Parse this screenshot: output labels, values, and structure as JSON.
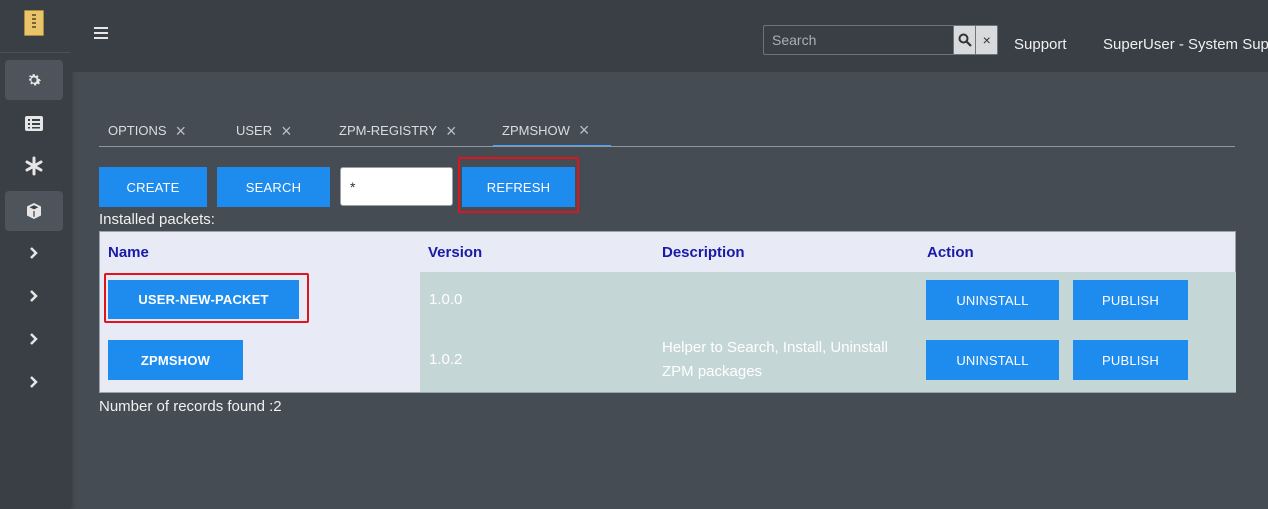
{
  "sidebar": {
    "items": [
      {
        "icon": "gear-icon"
      },
      {
        "icon": "list-icon"
      },
      {
        "icon": "asterisk-icon"
      },
      {
        "icon": "package-icon"
      },
      {
        "icon": "chevron-right-icon"
      },
      {
        "icon": "chevron-right-icon"
      },
      {
        "icon": "chevron-right-icon"
      },
      {
        "icon": "chevron-right-icon"
      }
    ]
  },
  "header": {
    "search_placeholder": "Search",
    "clear_label": "×",
    "support_label": "Support",
    "user_label": "SuperUser - System Sup"
  },
  "tabs": [
    {
      "label": "OPTIONS",
      "close": "×"
    },
    {
      "label": "USER",
      "close": "×"
    },
    {
      "label": "ZPM-REGISTRY",
      "close": "×"
    },
    {
      "label": "ZPMSHOW",
      "close": "×"
    }
  ],
  "toolbar": {
    "create_label": "CREATE",
    "search_label": "SEARCH",
    "filter_value": "*",
    "refresh_label": "REFRESH"
  },
  "caption": "Installed packets:",
  "table": {
    "headers": [
      "Name",
      "Version",
      "Description",
      "Action"
    ],
    "rows": [
      {
        "name": "USER-NEW-PACKET",
        "version": "1.0.0",
        "description": "",
        "uninstall": "UNINSTALL",
        "publish": "PUBLISH"
      },
      {
        "name": "ZPMSHOW",
        "version": "1.0.2",
        "description": "Helper to Search, Install, Uninstall ZPM packages",
        "uninstall": "UNINSTALL",
        "publish": "PUBLISH"
      }
    ]
  },
  "footer": "Number of records found :2",
  "colors": {
    "accent": "#1e8bef",
    "highlight": "#e0141b",
    "header_text": "#1a1aa8"
  }
}
